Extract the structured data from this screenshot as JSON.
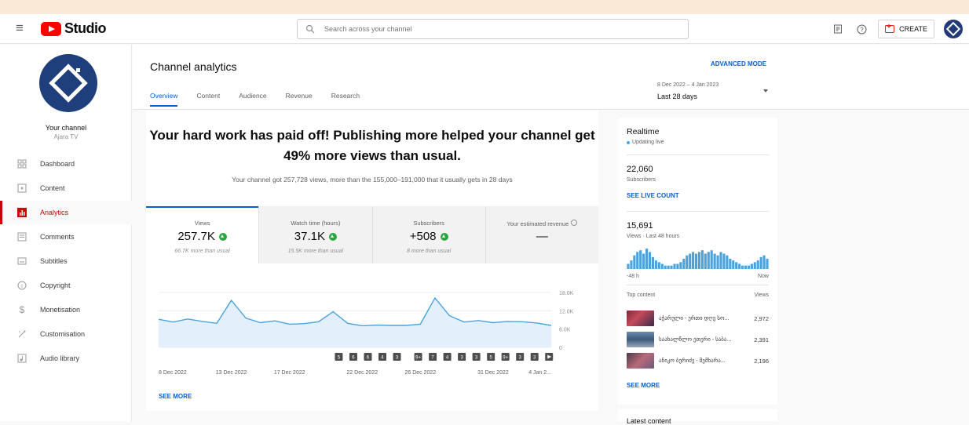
{
  "topbar": {
    "logo_text": "Studio",
    "search_placeholder": "Search across your channel",
    "create_label": "CREATE"
  },
  "sidebar": {
    "channel_name": "Your channel",
    "channel_handle": "Ajara TV",
    "items": [
      {
        "label": "Dashboard",
        "icon": "dashboard-icon"
      },
      {
        "label": "Content",
        "icon": "content-icon"
      },
      {
        "label": "Analytics",
        "icon": "analytics-icon",
        "active": true
      },
      {
        "label": "Comments",
        "icon": "comments-icon"
      },
      {
        "label": "Subtitles",
        "icon": "subtitles-icon"
      },
      {
        "label": "Copyright",
        "icon": "copyright-icon"
      },
      {
        "label": "Monetisation",
        "icon": "monetisation-icon"
      },
      {
        "label": "Customisation",
        "icon": "customisation-icon"
      },
      {
        "label": "Audio library",
        "icon": "audio-library-icon"
      }
    ]
  },
  "header": {
    "title": "Channel analytics",
    "tabs": [
      "Overview",
      "Content",
      "Audience",
      "Revenue",
      "Research"
    ],
    "advanced_mode": "ADVANCED MODE",
    "date_range": "8 Dec 2022 – 4 Jan 2023",
    "date_label": "Last 28 days"
  },
  "overview": {
    "headline": "Your hard work has paid off! Publishing more helped your channel get 49% more views than usual.",
    "subline": "Your channel got 257,728 views, more than the 155,000–191,000 that it usually gets in 28 days",
    "metrics": [
      {
        "label": "Views",
        "value": "257.7K",
        "note": "66.7K more than usual",
        "up": true
      },
      {
        "label": "Watch time (hours)",
        "value": "37.1K",
        "note": "15.5K more than usual",
        "up": true
      },
      {
        "label": "Subscribers",
        "value": "+508",
        "note": "8 more than usual",
        "up": true
      },
      {
        "label": "Your estimated revenue",
        "value": "—",
        "note": "",
        "up": false
      }
    ],
    "see_more": "SEE MORE"
  },
  "chart_data": {
    "type": "area",
    "title": "",
    "x": [
      "8 Dec 2022",
      "9 Dec",
      "10 Dec",
      "11 Dec",
      "12 Dec",
      "13 Dec 2022",
      "14 Dec",
      "15 Dec",
      "16 Dec",
      "17 Dec 2022",
      "18 Dec",
      "19 Dec",
      "20 Dec",
      "21 Dec",
      "22 Dec 2022",
      "23 Dec",
      "24 Dec",
      "25 Dec",
      "26 Dec 2022",
      "27 Dec",
      "28 Dec",
      "29 Dec",
      "30 Dec",
      "31 Dec 2022",
      "1 Jan",
      "2 Jan",
      "3 Jan",
      "4 Jan 2023"
    ],
    "x_tick_labels": [
      "8 Dec 2022",
      "13 Dec 2022",
      "17 Dec 2022",
      "22 Dec 2022",
      "26 Dec 2022",
      "31 Dec 2022",
      "4 Jan 2..."
    ],
    "series": [
      {
        "values": [
          9200,
          8300,
          9300,
          8500,
          7900,
          15400,
          9600,
          8100,
          8700,
          7600,
          7800,
          8400,
          11700,
          7900,
          7100,
          7300,
          7200,
          7200,
          7600,
          16200,
          10400,
          8300,
          8800,
          8100,
          8500,
          8400,
          8000,
          7200
        ]
      }
    ],
    "yticks": [
      "0",
      "6.0K",
      "12.0K",
      "18.0K"
    ],
    "ylim": [
      0,
      18000
    ],
    "upload_markers": [
      "5",
      "6",
      "6",
      "4",
      "3",
      "9+",
      "7",
      "4",
      "3",
      "3",
      "5",
      "9+",
      "3",
      "3",
      "play"
    ]
  },
  "realtime": {
    "title": "Realtime",
    "status": "Updating live",
    "subscribers": "22,060",
    "subscribers_label": "Subscribers",
    "see_live_count": "SEE LIVE COUNT",
    "views": "15,691",
    "views_label": "Views · Last 48 hours",
    "axis_left": "-48 h",
    "axis_right": "Now",
    "top_content_label": "Top content",
    "views_col_label": "Views",
    "top_content": [
      {
        "title": "აჭარული - ერთი დღე სო...",
        "views": "2,972"
      },
      {
        "title": "საახალწლო ეთერი - საბა...",
        "views": "2,391"
      },
      {
        "title": "ანიკო ბერიძე - შემხარა...",
        "views": "2,196"
      }
    ],
    "see_more": "SEE MORE",
    "bars": [
      3,
      5,
      8,
      10,
      11,
      9,
      12,
      10,
      7,
      5,
      4,
      3,
      2,
      2,
      2,
      3,
      3,
      4,
      6,
      8,
      9,
      10,
      9,
      10,
      11,
      9,
      10,
      11,
      9,
      8,
      10,
      9,
      8,
      6,
      5,
      4,
      3,
      2,
      2,
      2,
      3,
      4,
      5,
      7,
      8,
      6
    ]
  },
  "latest_content": {
    "title": "Latest content"
  }
}
